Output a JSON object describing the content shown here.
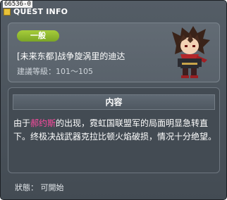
{
  "window": {
    "id_tag": "66536-0",
    "title": "QUEST INFO"
  },
  "quest": {
    "level_badge": "一般",
    "name": "[未来东都]战争旋涡里的迪达",
    "level_range": "建議等級：101～105"
  },
  "content": {
    "header": "内容",
    "text_before": "由于",
    "highlight": "郝约斯",
    "text_after": "的出现，霓虹国联盟军的局面明显急转直下。终极决战武器克拉比顿火焰破损，情况十分绝望。"
  },
  "status": "狀態： 可開始",
  "colors": {
    "badge": "#8fbb2e",
    "highlight": "#ff4aa0",
    "background": "#4b535b"
  }
}
